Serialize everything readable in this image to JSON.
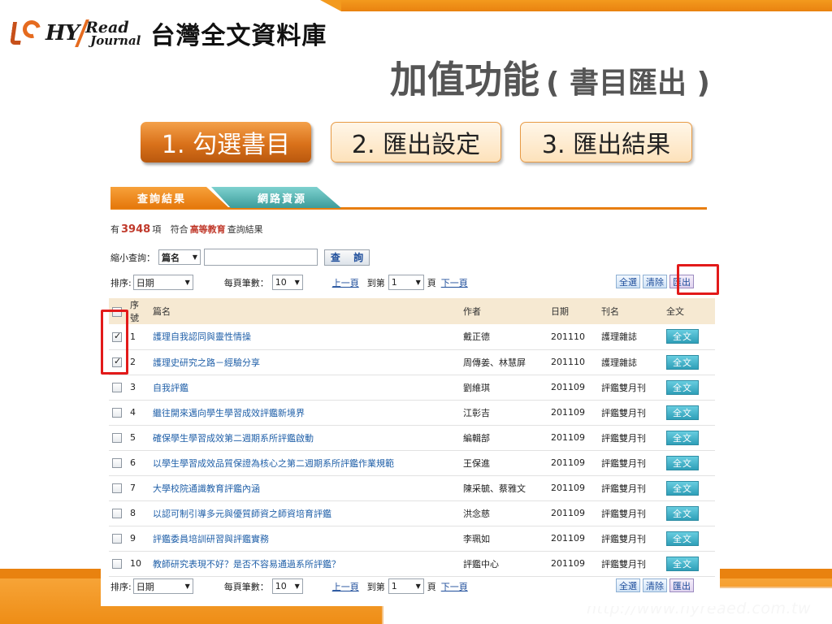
{
  "header": {
    "logo_hy": "HY",
    "logo_read": "Read",
    "logo_journal": "Journal",
    "brand_name": "台灣全文資料庫",
    "title_main": "加值功能",
    "title_sub": "( 書目匯出 )"
  },
  "steps": [
    {
      "label": "1. 勾選書目",
      "state": "active"
    },
    {
      "label": "2. 匯出設定",
      "state": "inactive"
    },
    {
      "label": "3. 匯出結果",
      "state": "inactive"
    }
  ],
  "footer": {
    "url": "http://www.hyreaed.com.tw"
  },
  "colors": {
    "accent_orange": "#e9820f",
    "tab_teal": "#3c9c9a",
    "link_blue": "#1f5fa8",
    "highlight_red": "#e21a1a",
    "count_red": "#c0392b"
  },
  "web": {
    "tabs": [
      {
        "label": "查詢結果"
      },
      {
        "label": "網路資源"
      }
    ],
    "summary": {
      "prefix": "有",
      "count": "3948",
      "unit": "項",
      "mid": "符合",
      "scope": "高等教育",
      "suffix": "查詢結果"
    },
    "refine": {
      "label": "縮小查詢：",
      "field_value": "篇名",
      "keyword_value": "",
      "button": "查 詢"
    },
    "pager": {
      "sort_label": "排序:",
      "sort_value": "日期",
      "per_page_label": "每頁筆數：",
      "per_page_value": "10",
      "prev": "上一頁",
      "goto_label": "到第",
      "page_value": "1",
      "page_unit": "頁",
      "next": "下一頁"
    },
    "actions": {
      "select_all": "全選",
      "clear": "清除",
      "export": "匯出"
    },
    "table": {
      "headers": {
        "no": "序號",
        "title": "篇名",
        "author": "作者",
        "date": "日期",
        "journal": "刊名",
        "fulltext": "全文"
      },
      "fulltext_label": "全文",
      "rows": [
        {
          "checked": true,
          "no": "1",
          "title": "護理自我認同與靈性情操",
          "author": "戴正德",
          "date": "201110",
          "journal": "護理雜誌"
        },
        {
          "checked": true,
          "no": "2",
          "title": "護理史研究之路－經驗分享",
          "author": "周傳姜、林慧屏",
          "date": "201110",
          "journal": "護理雜誌"
        },
        {
          "checked": false,
          "no": "3",
          "title": "自我評鑑",
          "author": "劉維琪",
          "date": "201109",
          "journal": "評鑑雙月刊"
        },
        {
          "checked": false,
          "no": "4",
          "title": "繼往開來邁向學生學習成效評鑑新境界",
          "author": "江彰吉",
          "date": "201109",
          "journal": "評鑑雙月刊"
        },
        {
          "checked": false,
          "no": "5",
          "title": "確保學生學習成效第二週期系所評鑑啟動",
          "author": "編輯部",
          "date": "201109",
          "journal": "評鑑雙月刊"
        },
        {
          "checked": false,
          "no": "6",
          "title": "以學生學習成效品質保證為核心之第二週期系所評鑑作業規範",
          "author": "王保進",
          "date": "201109",
          "journal": "評鑑雙月刊"
        },
        {
          "checked": false,
          "no": "7",
          "title": "大學校院通識教育評鑑內涵",
          "author": "陳采毓、蔡雅文",
          "date": "201109",
          "journal": "評鑑雙月刊"
        },
        {
          "checked": false,
          "no": "8",
          "title": "以認可制引導多元與優質師資之師資培育評鑑",
          "author": "洪念慈",
          "date": "201109",
          "journal": "評鑑雙月刊"
        },
        {
          "checked": false,
          "no": "9",
          "title": "評鑑委員培訓研習與評鑑實務",
          "author": "李珮如",
          "date": "201109",
          "journal": "評鑑雙月刊"
        },
        {
          "checked": false,
          "no": "10",
          "title": "教師研究表現不好？是否不容易通過系所評鑑？",
          "author": "評鑑中心",
          "date": "201109",
          "journal": "評鑑雙月刊"
        }
      ]
    }
  }
}
